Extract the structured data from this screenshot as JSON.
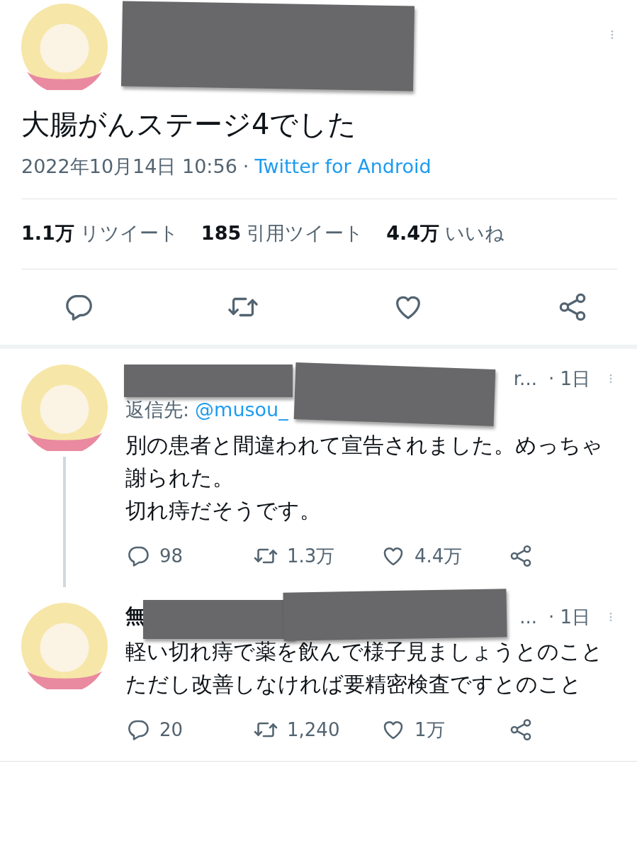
{
  "main_tweet": {
    "text": "大腸がんステージ4でした",
    "date": "2022年10月14日 10:56",
    "separator": "·",
    "source": "Twitter for Android",
    "stats": [
      {
        "count": "1.1万",
        "label": "リツイート"
      },
      {
        "count": "185",
        "label": "引用ツイート"
      },
      {
        "count": "4.4万",
        "label": "いいね"
      }
    ]
  },
  "replies": [
    {
      "name_tail": "r...",
      "time": "· 1日",
      "reply_to_label": "返信先:",
      "reply_to_handle": "@musou_",
      "threaded": true,
      "lines": [
        "別の患者と間違われて宣告されました。めっちゃ謝られた。",
        "切れ痔だそうです。"
      ],
      "replies": "98",
      "retweets": "1.3万",
      "likes": "4.4万"
    },
    {
      "name_head": "無",
      "name_tail": "...",
      "time": "· 1日",
      "threaded": false,
      "lines": [
        "軽い切れ痔で薬を飲んで様子見ましょうとのこと",
        "ただし改善しなければ要精密検査ですとのこと"
      ],
      "replies": "20",
      "retweets": "1,240",
      "likes": "1万"
    }
  ]
}
